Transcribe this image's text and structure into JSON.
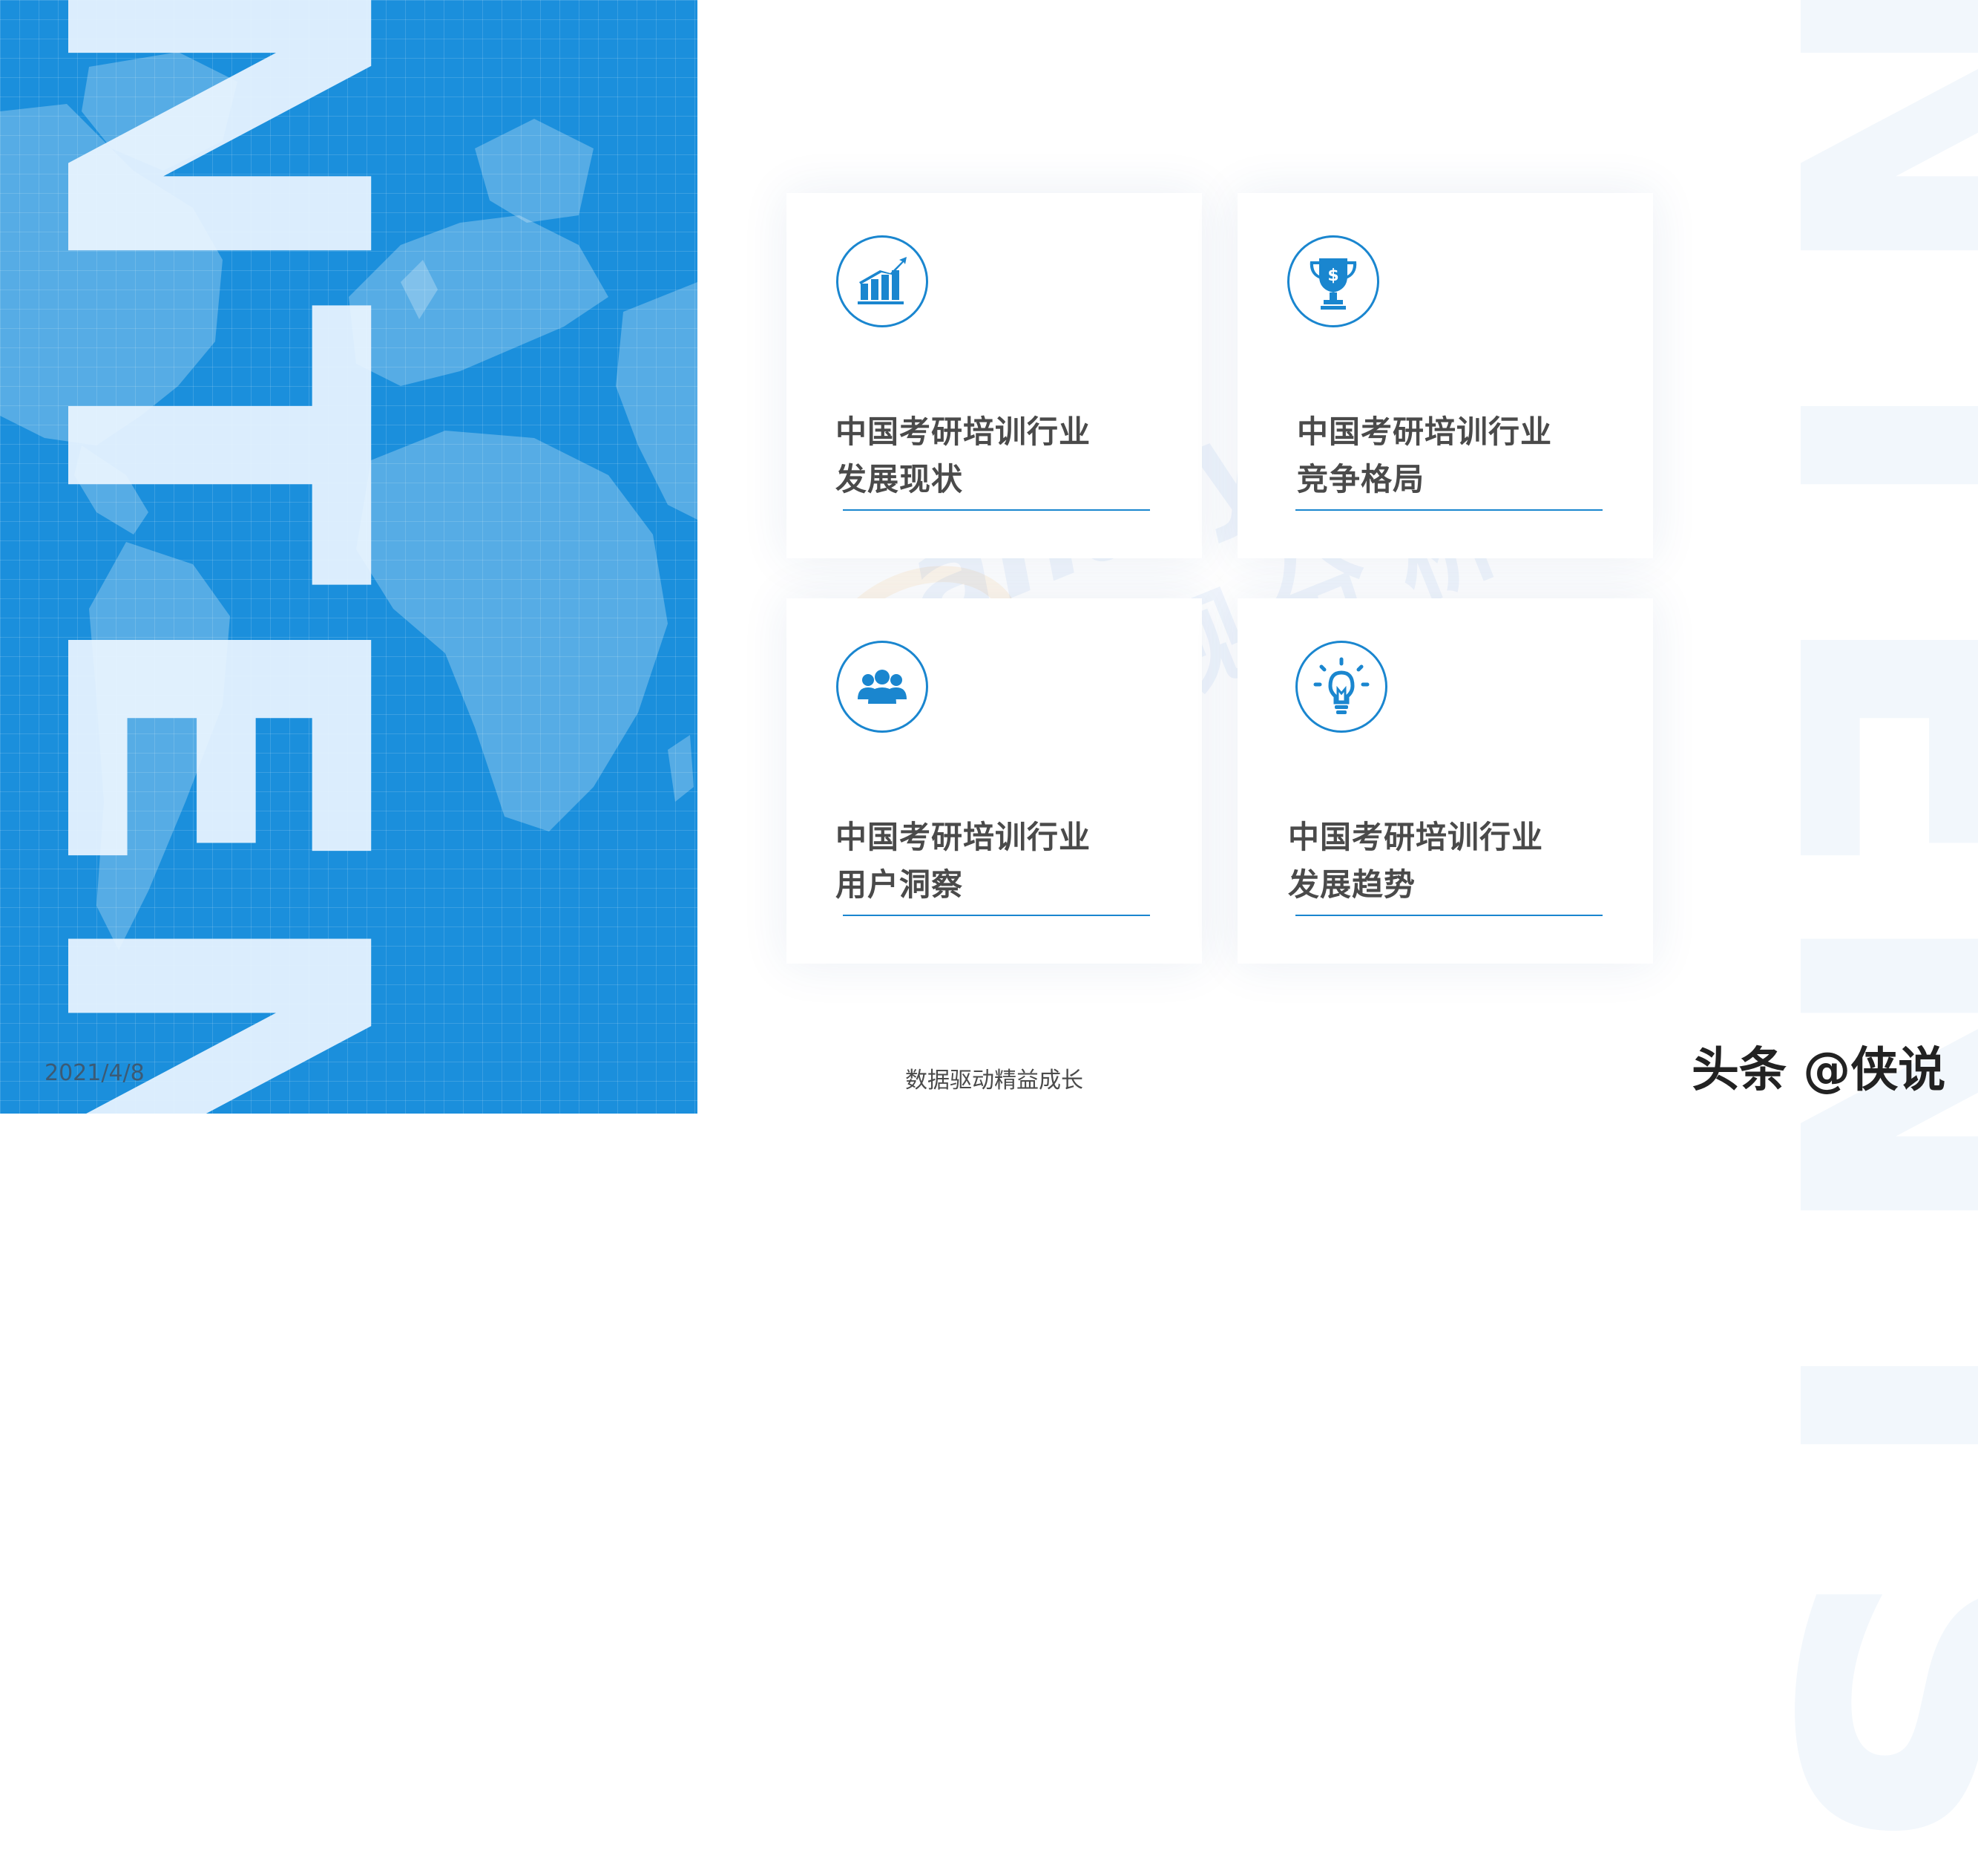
{
  "left_panel": {
    "big_word": "CONTENTS",
    "date": "2021/4/8"
  },
  "watermark": {
    "english": "analysys",
    "chinese": "易观分析"
  },
  "cards": [
    {
      "title_line1": "中国考研培训行业",
      "title_line2": "发展现状",
      "icon": "bar-chart-growth-icon"
    },
    {
      "title_line1": "中国考研培训行业",
      "title_line2": "竞争格局",
      "icon": "trophy-dollar-icon"
    },
    {
      "title_line1": "中国考研培训行业",
      "title_line2": "用户洞察",
      "icon": "users-group-icon"
    },
    {
      "title_line1": "中国考研培训行业",
      "title_line2": "发展趋势",
      "icon": "lightbulb-icon"
    }
  ],
  "footer": {
    "slogan": "数据驱动精益成长",
    "brand": "头条 @侠说"
  },
  "colors": {
    "panel_blue": "#1b8fdc",
    "accent_blue": "#1a86cf",
    "title_gray": "#4a4a4a"
  }
}
